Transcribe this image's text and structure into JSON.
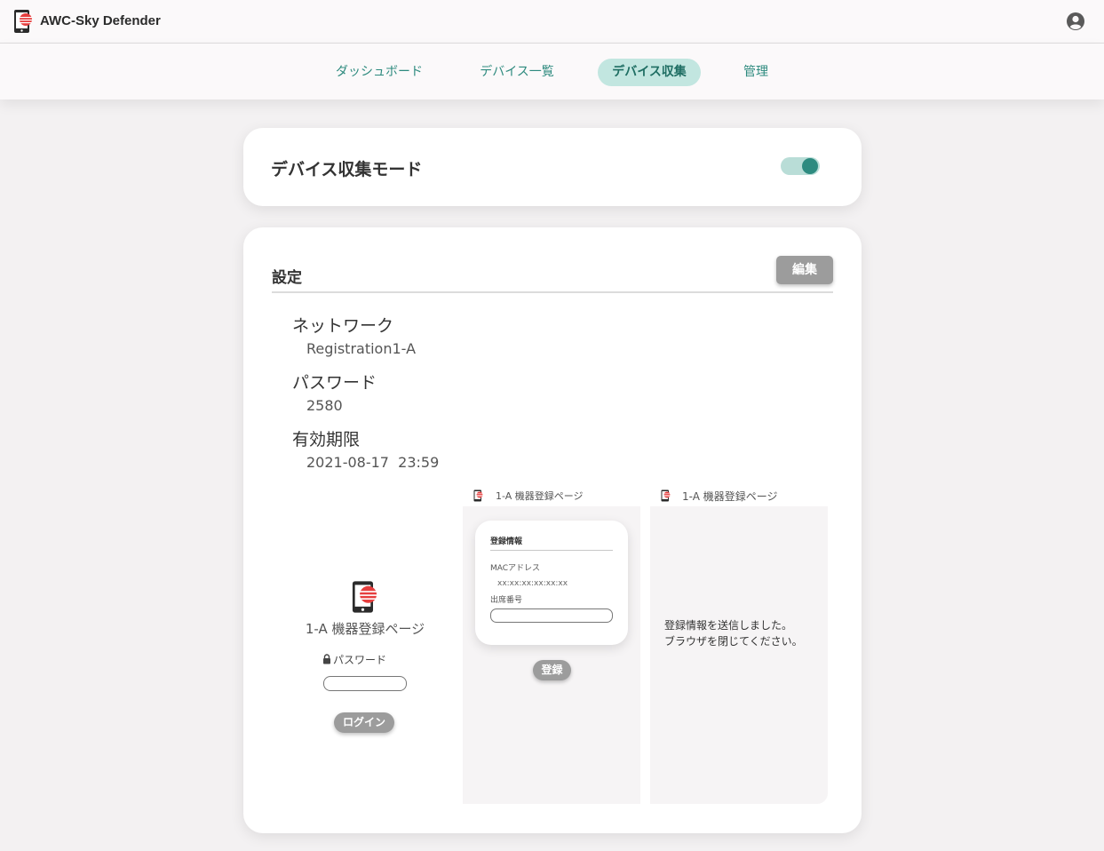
{
  "app": {
    "title": "AWC-Sky Defender"
  },
  "nav": {
    "tabs": [
      {
        "label": "ダッシュボード",
        "active": false
      },
      {
        "label": "デバイス一覧",
        "active": false
      },
      {
        "label": "デバイス収集",
        "active": true
      },
      {
        "label": "管理",
        "active": false
      }
    ]
  },
  "mode": {
    "title": "デバイス収集モード",
    "enabled": true
  },
  "settings": {
    "title": "設定",
    "edit_label": "編集",
    "network_label": "ネットワーク",
    "network_value": "Registration1-A",
    "password_label": "パスワード",
    "password_value": "2580",
    "expiry_label": "有効期限",
    "expiry_value": "2021-08-17  23:59"
  },
  "preview": {
    "login": {
      "title": "1-A 機器登録ページ",
      "password_label": "パスワード",
      "login_button": "ログイン"
    },
    "register": {
      "page_title": "1-A 機器登録ページ",
      "card_title": "登録情報",
      "mac_label": "MACアドレス",
      "mac_value": "xx:xx:xx:xx:xx:xx",
      "seat_label": "出席番号",
      "register_button": "登録"
    },
    "done": {
      "page_title": "1-A 機器登録ページ",
      "message_line1": "登録情報を送信しました。",
      "message_line2": "ブラウザを閉じてください。"
    }
  },
  "colors": {
    "accent": "#2e8b80",
    "accent_light": "#c2e6e0",
    "logo_red": "#e63e3e"
  }
}
